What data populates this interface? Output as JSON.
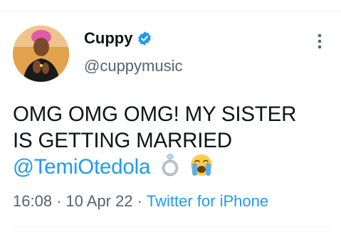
{
  "author": {
    "display_name": "Cuppy",
    "handle": "@cuppymusic",
    "verified": true,
    "avatar_icon": "profile-photo"
  },
  "tweet": {
    "line1": "OMG OMG OMG!  MY SISTER",
    "line2": "IS GETTING MARRIED",
    "mention": "@TemiOtedola",
    "emojis": [
      "ring-emoji",
      "loudly-crying-face-emoji"
    ]
  },
  "meta": {
    "time": "16:08",
    "separator": "·",
    "date": "10 Apr 22",
    "source": "Twitter for iPhone"
  },
  "colors": {
    "accent": "#1d9bf0",
    "secondary_text": "#536471",
    "primary_text": "#0f1419",
    "divider": "#eff3f4"
  }
}
